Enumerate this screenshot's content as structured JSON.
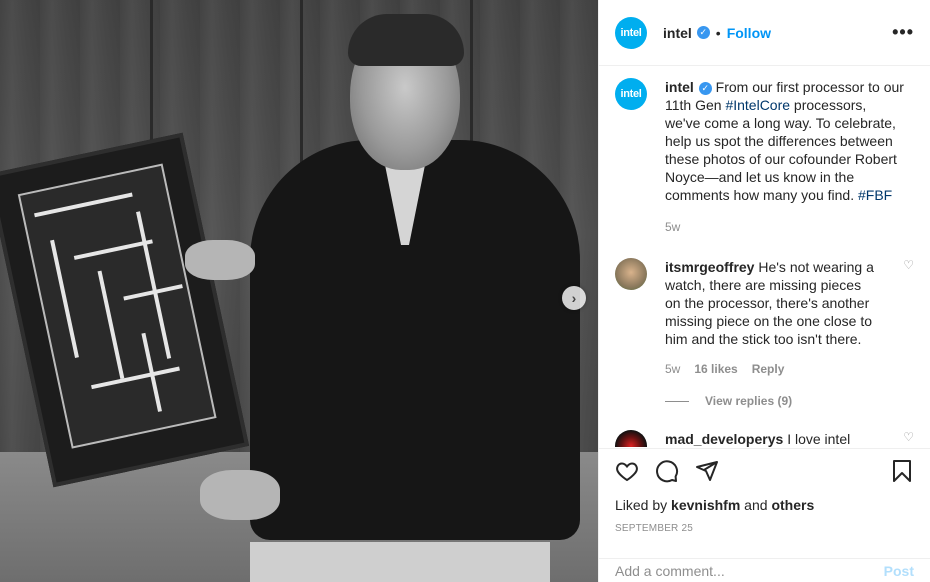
{
  "post": {
    "account": "intel",
    "logo_text": "intel",
    "follow_label": "Follow",
    "dot": "•",
    "more_label": "•••",
    "next_label": "›"
  },
  "caption": {
    "user": "intel",
    "text_1": "From our first processor to our 11th Gen ",
    "tag_1": "#IntelCore",
    "text_2": " processors, we've come a long way. To celebrate, help us spot the differences between these photos of our cofounder Robert Noyce—and let us know in the comments how many you find. ",
    "tag_2": "#FBF",
    "time": "5w"
  },
  "comments": [
    {
      "user": "itsmrgeoffrey",
      "text": "He's not wearing a watch, there are missing pieces on the processor, there's another missing piece on the one close to him and the stick too isn't there.",
      "time": "5w",
      "likes": "16 likes",
      "reply_label": "Reply",
      "view_replies": "View replies (9)"
    },
    {
      "user": "mad_developerys",
      "text": "I love intel"
    }
  ],
  "footer": {
    "liked_prefix": "Liked by ",
    "liked_user": "kevnishfm",
    "liked_mid": " and ",
    "liked_others": "others",
    "date": "SEPTEMBER 25",
    "comment_placeholder": "Add a comment...",
    "post_label": "Post"
  },
  "colors": {
    "brand": "#00aeef",
    "link": "#0095f6",
    "verified": "#3897f0"
  }
}
